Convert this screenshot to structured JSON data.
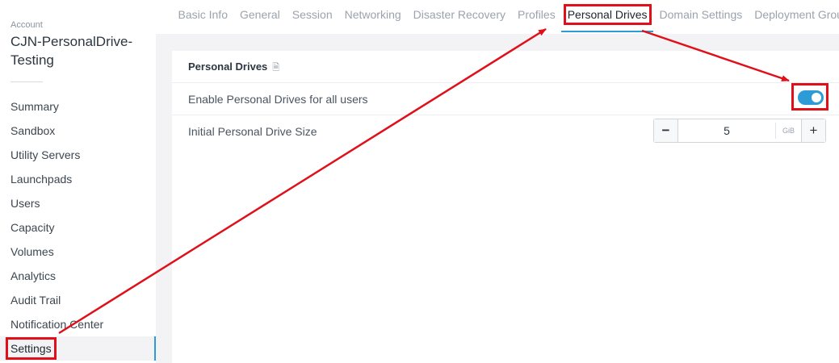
{
  "sidebar": {
    "account_label": "Account",
    "account_name": "CJN-PersonalDrive-Testing",
    "items": [
      {
        "label": "Summary"
      },
      {
        "label": "Sandbox"
      },
      {
        "label": "Utility Servers"
      },
      {
        "label": "Launchpads"
      },
      {
        "label": "Users"
      },
      {
        "label": "Capacity"
      },
      {
        "label": "Volumes"
      },
      {
        "label": "Analytics"
      },
      {
        "label": "Audit Trail"
      },
      {
        "label": "Notification Center"
      },
      {
        "label": "Settings",
        "active": true
      }
    ]
  },
  "tabs": [
    {
      "label": "Basic Info"
    },
    {
      "label": "General"
    },
    {
      "label": "Session"
    },
    {
      "label": "Networking"
    },
    {
      "label": "Disaster Recovery"
    },
    {
      "label": "Profiles"
    },
    {
      "label": "Personal Drives",
      "active": true
    },
    {
      "label": "Domain Settings"
    },
    {
      "label": "Deployment Group"
    }
  ],
  "panel": {
    "title": "Personal Drives",
    "title_icon": "document-icon",
    "enable_label": "Enable Personal Drives for all users",
    "enable_value": true,
    "size_label": "Initial Personal Drive Size",
    "size_value": "5",
    "size_unit": "GiB",
    "decrement_label": "−",
    "increment_label": "+"
  },
  "colors": {
    "accent": "#2c9bd6",
    "annotation": "#e0101a"
  }
}
